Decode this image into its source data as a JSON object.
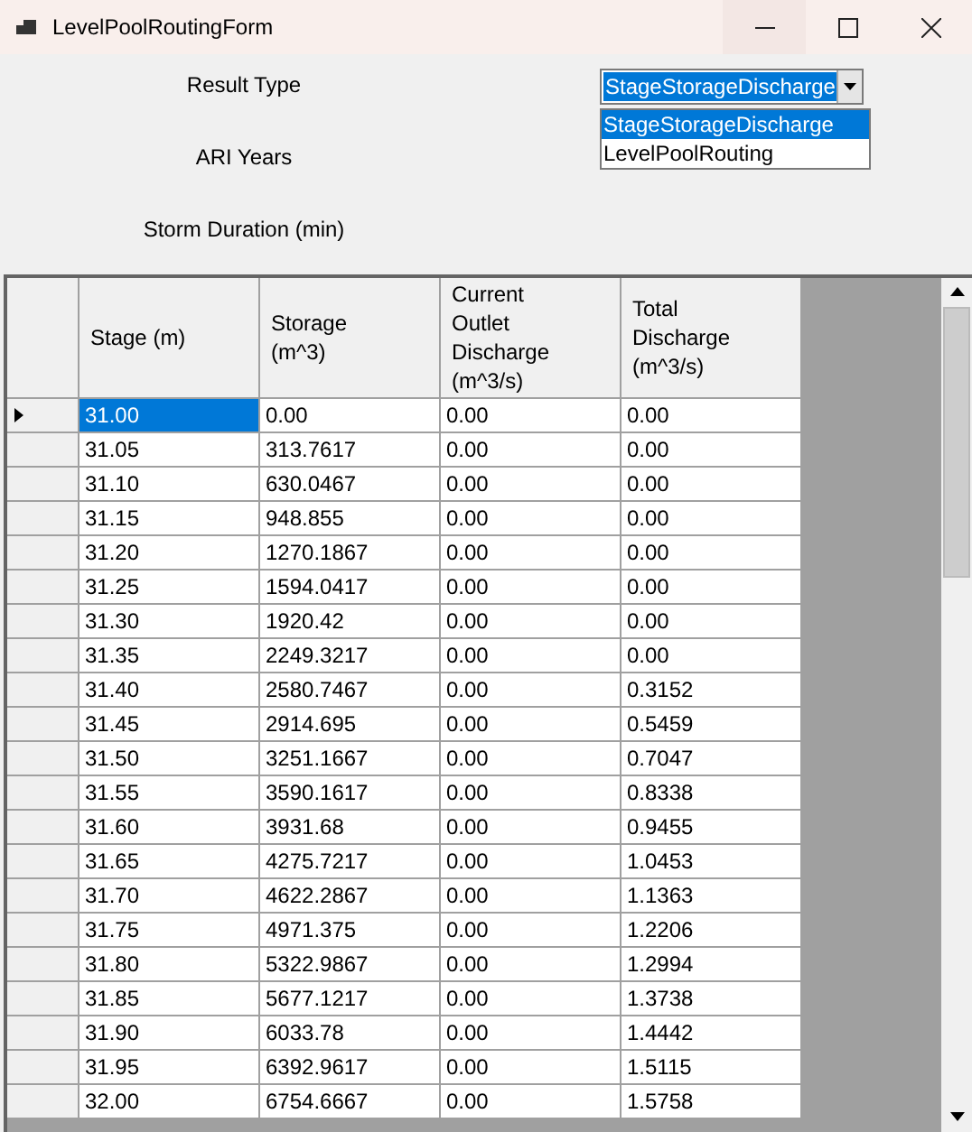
{
  "window": {
    "title": "LevelPoolRoutingForm"
  },
  "form": {
    "labels": [
      "Result Type",
      "ARI Years",
      "Storm Duration (min)"
    ],
    "result_type": {
      "value": "StageStorageDischarge",
      "expanded": true,
      "options": [
        {
          "label": "StageStorageDischarge",
          "selected": true
        },
        {
          "label": "LevelPoolRouting",
          "selected": false
        }
      ]
    }
  },
  "table": {
    "columns": [
      "Stage (m)",
      "Storage (m^3)",
      "Current Outlet Discharge (m^3/s)",
      "Total Discharge (m^3/s)"
    ],
    "rows": [
      {
        "selected": true,
        "cells": [
          "31.00",
          "0.00",
          "0.00",
          "0.00"
        ]
      },
      {
        "selected": false,
        "cells": [
          "31.05",
          "313.7617",
          "0.00",
          "0.00"
        ]
      },
      {
        "selected": false,
        "cells": [
          "31.10",
          "630.0467",
          "0.00",
          "0.00"
        ]
      },
      {
        "selected": false,
        "cells": [
          "31.15",
          "948.855",
          "0.00",
          "0.00"
        ]
      },
      {
        "selected": false,
        "cells": [
          "31.20",
          "1270.1867",
          "0.00",
          "0.00"
        ]
      },
      {
        "selected": false,
        "cells": [
          "31.25",
          "1594.0417",
          "0.00",
          "0.00"
        ]
      },
      {
        "selected": false,
        "cells": [
          "31.30",
          "1920.42",
          "0.00",
          "0.00"
        ]
      },
      {
        "selected": false,
        "cells": [
          "31.35",
          "2249.3217",
          "0.00",
          "0.00"
        ]
      },
      {
        "selected": false,
        "cells": [
          "31.40",
          "2580.7467",
          "0.00",
          "0.3152"
        ]
      },
      {
        "selected": false,
        "cells": [
          "31.45",
          "2914.695",
          "0.00",
          "0.5459"
        ]
      },
      {
        "selected": false,
        "cells": [
          "31.50",
          "3251.1667",
          "0.00",
          "0.7047"
        ]
      },
      {
        "selected": false,
        "cells": [
          "31.55",
          "3590.1617",
          "0.00",
          "0.8338"
        ]
      },
      {
        "selected": false,
        "cells": [
          "31.60",
          "3931.68",
          "0.00",
          "0.9455"
        ]
      },
      {
        "selected": false,
        "cells": [
          "31.65",
          "4275.7217",
          "0.00",
          "1.0453"
        ]
      },
      {
        "selected": false,
        "cells": [
          "31.70",
          "4622.2867",
          "0.00",
          "1.1363"
        ]
      },
      {
        "selected": false,
        "cells": [
          "31.75",
          "4971.375",
          "0.00",
          "1.2206"
        ]
      },
      {
        "selected": false,
        "cells": [
          "31.80",
          "5322.9867",
          "0.00",
          "1.2994"
        ]
      },
      {
        "selected": false,
        "cells": [
          "31.85",
          "5677.1217",
          "0.00",
          "1.3738"
        ]
      },
      {
        "selected": false,
        "cells": [
          "31.90",
          "6033.78",
          "0.00",
          "1.4442"
        ]
      },
      {
        "selected": false,
        "cells": [
          "31.95",
          "6392.9617",
          "0.00",
          "1.5115"
        ]
      },
      {
        "selected": false,
        "cells": [
          "32.00",
          "6754.6667",
          "0.00",
          "1.5758"
        ]
      }
    ]
  }
}
